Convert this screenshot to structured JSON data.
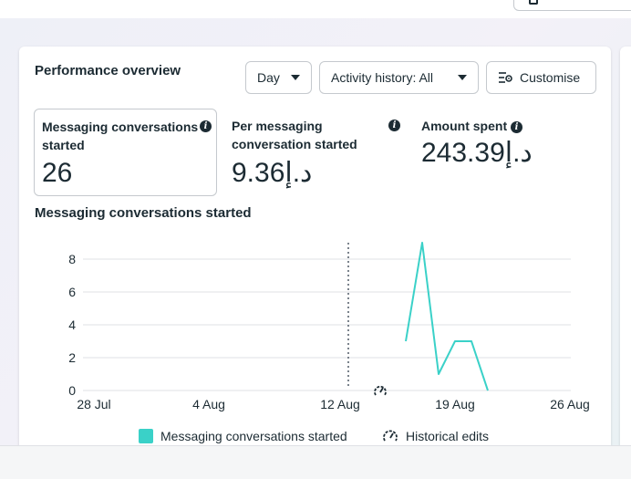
{
  "card": {
    "title": "Performance overview",
    "buttons": {
      "day_label": "Day",
      "activity_label": "Activity history: All",
      "customise_label": "Customise"
    }
  },
  "metrics": [
    {
      "label": "Messaging conversations started",
      "value": "26"
    },
    {
      "label": "Per messaging conversation started",
      "value": "د.إ9.36"
    },
    {
      "label": "Amount spent",
      "value": "د.إ243.39"
    }
  ],
  "chart_section_title": "Messaging conversations started",
  "chart_data": {
    "type": "line",
    "x": [
      "16 Aug",
      "17 Aug",
      "18 Aug",
      "19 Aug",
      "20 Aug",
      "21 Aug"
    ],
    "x_ticks": [
      "28 Jul",
      "4 Aug",
      "12 Aug",
      "19 Aug",
      "26 Aug"
    ],
    "y_ticks": [
      0,
      2,
      4,
      6,
      8
    ],
    "ylim": [
      0,
      9
    ],
    "series": [
      {
        "name": "Messaging conversations started",
        "values": [
          3,
          9,
          1,
          3,
          3,
          0
        ],
        "color": "#3ad1c8"
      }
    ],
    "annotations": [
      "historical-edit marker at 15 Aug"
    ],
    "grid": true,
    "legend_position": "bottom"
  },
  "legend": {
    "series_label": "Messaging conversations started",
    "edits_label": "Historical edits"
  },
  "colors": {
    "series": "#3ad1c8",
    "text": "#1c2b33",
    "border": "#c5c9ce",
    "grid": "#dfe1e5"
  }
}
